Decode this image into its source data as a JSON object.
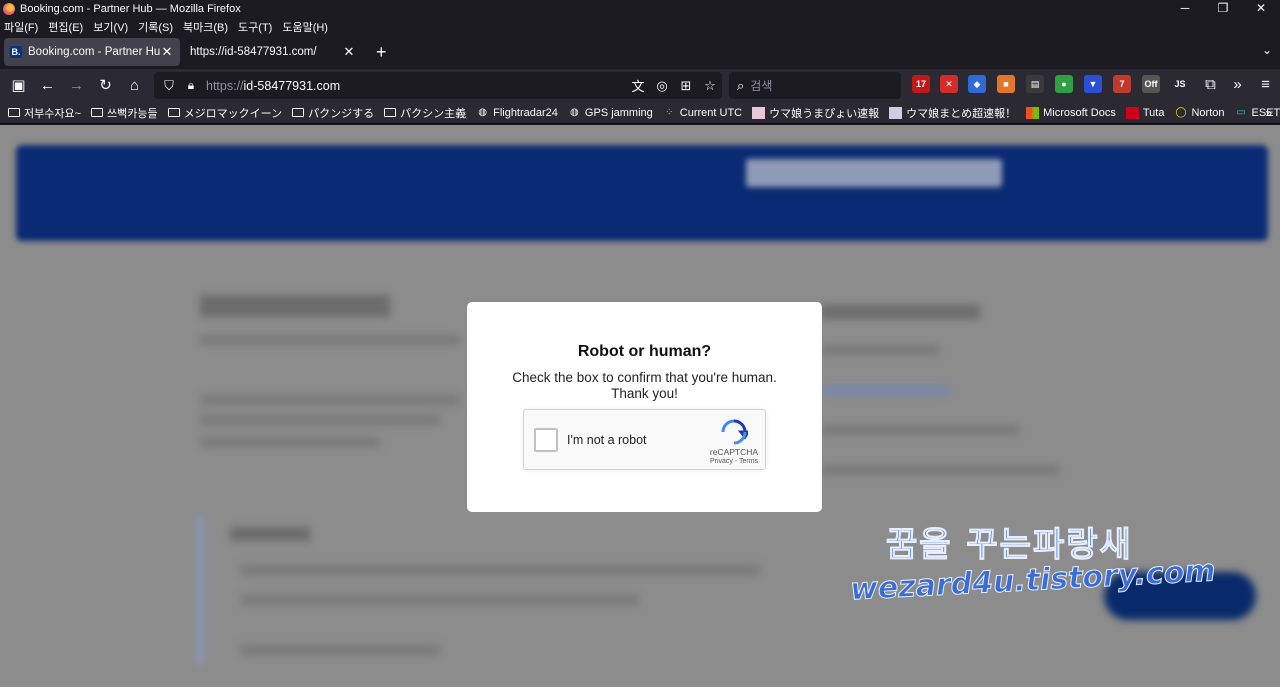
{
  "window": {
    "title": "Booking.com - Partner Hub — Mozilla Firefox",
    "controls": [
      "─",
      "❐",
      "✕"
    ]
  },
  "menu": [
    "파일(F)",
    "편집(E)",
    "보기(V)",
    "기록(S)",
    "북마크(B)",
    "도구(T)",
    "도움말(H)"
  ],
  "tabs": [
    {
      "label": "Booking.com - Partner Hub",
      "favicon": "B.",
      "active": true
    },
    {
      "label": "https://id-58477931.com/",
      "active": false
    }
  ],
  "navbar": {
    "url_protocol": "https://",
    "url_host": "id-58477931.com",
    "search_placeholder": "검색"
  },
  "extensions": [
    {
      "badge": "17",
      "color": "#c01818"
    },
    {
      "badge": "✕",
      "color": "#d42b2b"
    },
    {
      "badge": "◆",
      "color": "#2f6bd8"
    },
    {
      "badge": "■",
      "color": "#e3762b"
    },
    {
      "badge": "▤",
      "color": "#3a3a3a"
    },
    {
      "badge": "●",
      "color": "#2ea043"
    },
    {
      "badge": "▼",
      "color": "#2c4fd8"
    },
    {
      "badge": "7",
      "color": "#c0392b"
    },
    {
      "badge": "Off",
      "color": "#555555"
    },
    {
      "badge": "JS",
      "color": "#2b2a33"
    }
  ],
  "bookmarks": [
    {
      "label": "저부수자요~",
      "icon": "folder"
    },
    {
      "label": "쓰뻑카능들",
      "icon": "folder"
    },
    {
      "label": "メジロマックイーン",
      "icon": "folder"
    },
    {
      "label": "パクンジする",
      "icon": "folder"
    },
    {
      "label": "パクシン主義",
      "icon": "folder"
    },
    {
      "label": "Flightradar24",
      "icon": "globe"
    },
    {
      "label": "GPS jamming",
      "icon": "globe"
    },
    {
      "label": "Current UTC",
      "icon": "dots"
    },
    {
      "label": "ウマ娘うまぴょい速報",
      "icon": "img"
    },
    {
      "label": "ウマ娘まとめ超速報！",
      "icon": "img"
    },
    {
      "label": "Microsoft Docs",
      "icon": "ms"
    },
    {
      "label": "Tuta",
      "icon": "tuta"
    },
    {
      "label": "Norton",
      "icon": "norton"
    },
    {
      "label": "ESET lab",
      "icon": "eset"
    }
  ],
  "captcha": {
    "title": "Robot or human?",
    "message": "Check the box to confirm that you're human. Thank you!",
    "checkbox_label": "I'm not a robot",
    "brand": "reCAPTCHA",
    "terms": "Privacy - Terms"
  },
  "watermark": {
    "line1": "꿈을 꾸는파랑새",
    "line2": "wezard4u.tistory.com"
  }
}
